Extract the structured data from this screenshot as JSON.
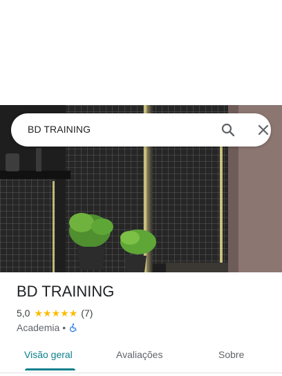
{
  "search": {
    "query": "BD TRAINING"
  },
  "icons": {
    "search": "search-icon",
    "close": "close-icon",
    "accessibility": "wheelchair-icon"
  },
  "place": {
    "name": "BD TRAINING",
    "rating": "5,0",
    "stars": 5,
    "review_count": "(7)",
    "category": "Academia",
    "separator": "•"
  },
  "tabs": [
    {
      "label": "Visão geral",
      "active": true
    },
    {
      "label": "Avaliações",
      "active": false
    },
    {
      "label": "Sobre",
      "active": false
    }
  ],
  "colors": {
    "accent": "#0b7e8b",
    "star": "#fbbc04",
    "accessibility": "#1a73e8"
  }
}
